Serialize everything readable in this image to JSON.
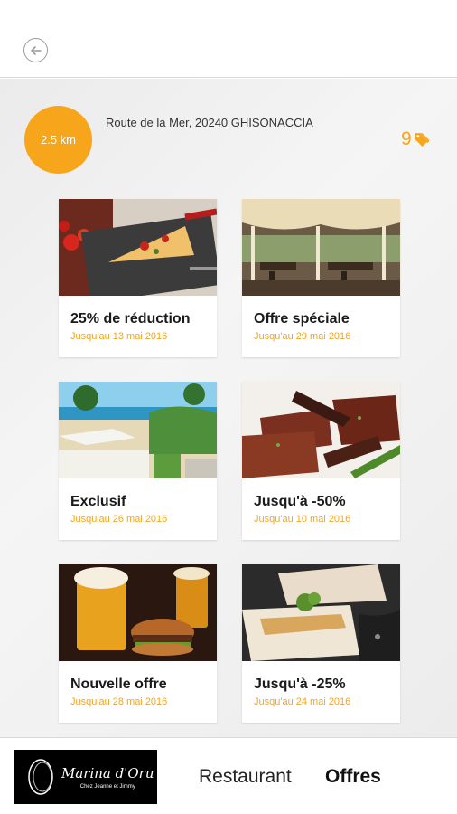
{
  "header": {
    "back_icon": "arrow-left-icon"
  },
  "restaurant": {
    "distance": "2.5 km",
    "address": "Route de la Mer, 20240 GHISONACCIA",
    "offer_count": "9",
    "tag_icon": "tag-icon",
    "accent_color": "#f7a51b"
  },
  "offers": [
    {
      "title": "25% de réduction",
      "date": "Jusqu'au 13 mai 2016",
      "image": "pizza"
    },
    {
      "title": "Offre spéciale",
      "date": "Jusqu'au 29 mai 2016",
      "image": "terrace"
    },
    {
      "title": "Exclusif",
      "date": "Jusqu'au 26 mai 2016",
      "image": "beach"
    },
    {
      "title": "Jusqu'à -50%",
      "date": "Jusqu'au 10 mai 2016",
      "image": "grill"
    },
    {
      "title": "Nouvelle offre",
      "date": "Jusqu'au 28 mai 2016",
      "image": "beer-burger"
    },
    {
      "title": "Jusqu'à -25%",
      "date": "Jusqu'au 24 mai 2016",
      "image": "fish"
    }
  ],
  "footer": {
    "logo_name": "Marina d'Oru",
    "logo_sub": "Chez Jeanne et Jimmy",
    "tabs": [
      {
        "label": "Restaurant",
        "active": false
      },
      {
        "label": "Offres",
        "active": true
      }
    ]
  }
}
